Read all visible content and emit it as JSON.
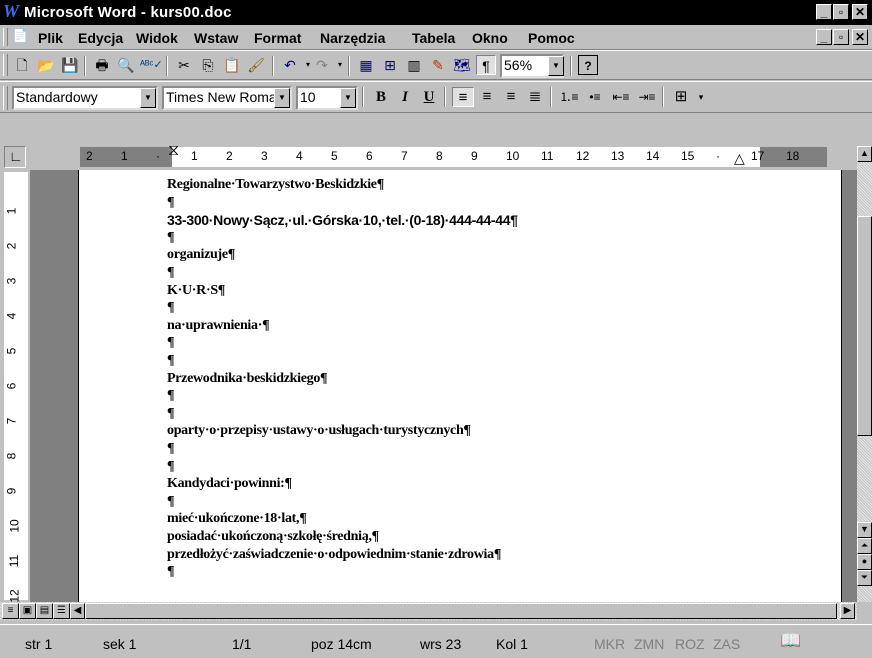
{
  "window": {
    "title": "Microsoft Word - kurs00.doc",
    "icon": "word-icon"
  },
  "menu": {
    "items": [
      {
        "label": "Plik"
      },
      {
        "label": "Edycja"
      },
      {
        "label": "Widok"
      },
      {
        "label": "Wstaw"
      },
      {
        "label": "Format"
      },
      {
        "label": "Narzędzia"
      },
      {
        "label": "Tabela"
      },
      {
        "label": "Okno"
      },
      {
        "label": "Pomoc"
      }
    ]
  },
  "toolbar": {
    "zoom": "56%"
  },
  "formatting": {
    "style": "Standardowy",
    "font": "Times New Roman",
    "size": "10",
    "bold": "B",
    "italic": "I",
    "underline": "U"
  },
  "ruler": {
    "h_ticks": [
      "2",
      "1",
      "",
      "1",
      "2",
      "3",
      "4",
      "5",
      "6",
      "7",
      "8",
      "9",
      "10",
      "11",
      "12",
      "13",
      "14",
      "15",
      "",
      "17",
      "18"
    ],
    "v_ticks": [
      "1",
      "2",
      "3",
      "4",
      "5",
      "6",
      "7",
      "8",
      "9",
      "10",
      "11",
      "12"
    ]
  },
  "document": {
    "lines": [
      {
        "text": "Regionalne·Towarzystwo·Beskidzkie¶",
        "style": "serif"
      },
      {
        "text": "¶",
        "style": "serif"
      },
      {
        "text": "33-300·Nowy·Sącz,·ul.·Górska·10,·tel.·(0-18)·444-44-44¶",
        "style": "sans"
      },
      {
        "text": "¶",
        "style": "serif"
      },
      {
        "text": "organizuje¶",
        "style": "serif"
      },
      {
        "text": "¶",
        "style": "serif"
      },
      {
        "text": "K·U·R·S¶",
        "style": "serif"
      },
      {
        "text": "¶",
        "style": "serif"
      },
      {
        "text": "na·uprawnienia·¶",
        "style": "serif"
      },
      {
        "text": "¶",
        "style": "serif"
      },
      {
        "text": "¶",
        "style": "serif"
      },
      {
        "text": "Przewodnika·beskidzkiego¶",
        "style": "serif"
      },
      {
        "text": "¶",
        "style": "serif"
      },
      {
        "text": "¶",
        "style": "serif"
      },
      {
        "text": "oparty·o·przepisy·ustawy·o·usługach·turystycznych¶",
        "style": "serif"
      },
      {
        "text": "¶",
        "style": "serif"
      },
      {
        "text": "¶",
        "style": "serif"
      },
      {
        "text": "Kandydaci·powinni:¶",
        "style": "serif"
      },
      {
        "text": "¶",
        "style": "serif"
      },
      {
        "text": "mieć·ukończone·18·lat,¶",
        "style": "serif"
      },
      {
        "text": "posiadać·ukończoną·szkołę·średnią,¶",
        "style": "serif"
      },
      {
        "text": "przedłożyć·zaświadczenie·o·odpowiednim·stanie·zdrowia¶",
        "style": "serif"
      },
      {
        "text": "¶",
        "style": "serif"
      }
    ]
  },
  "status": {
    "page": "str 1",
    "section": "sek 1",
    "pages": "1/1",
    "position": "poz 14cm",
    "line": "wrs 23",
    "column": "Kol 1",
    "mkr": "MKR",
    "zmn": "ZMN",
    "roz": "ROZ",
    "zas": "ZAS"
  }
}
